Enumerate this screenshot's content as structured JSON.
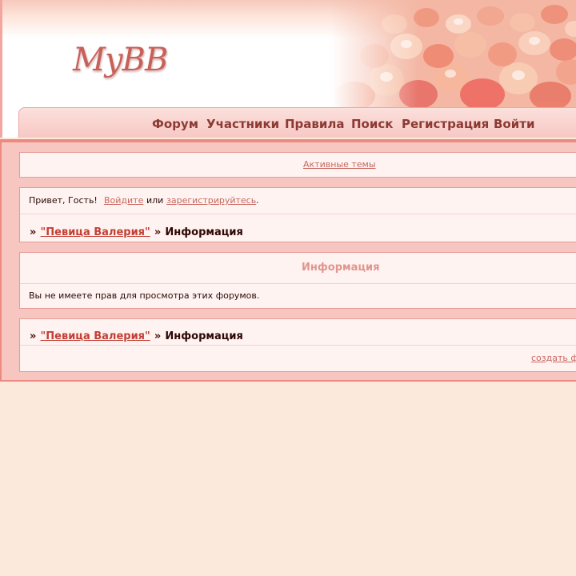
{
  "header": {
    "logo": "MyBB"
  },
  "nav": {
    "items": [
      {
        "label": "Форум"
      },
      {
        "label": "Участники"
      },
      {
        "label": "Правила"
      },
      {
        "label": "Поиск"
      },
      {
        "label": "Регистрация"
      },
      {
        "label": "Войти"
      }
    ]
  },
  "active_topics": {
    "label": "Активные темы"
  },
  "welcome": {
    "greeting": "Привет, Гость!",
    "login_link": "Войдите",
    "or_text": "или",
    "register_link": "зарегистрируйтесь",
    "period": "."
  },
  "breadcrumb": {
    "separator": "»",
    "forum_link": "\"Певица Валерия\"",
    "current": "Информация"
  },
  "info": {
    "title": "Информация",
    "message": "Вы не имеете прав для просмотра этих форумов."
  },
  "footer": {
    "create_link": "создать ф"
  },
  "colors": {
    "background": "#fbe9db",
    "accent": "#ec8a82",
    "link": "#c7675f",
    "nav_text": "#8c3a33"
  }
}
